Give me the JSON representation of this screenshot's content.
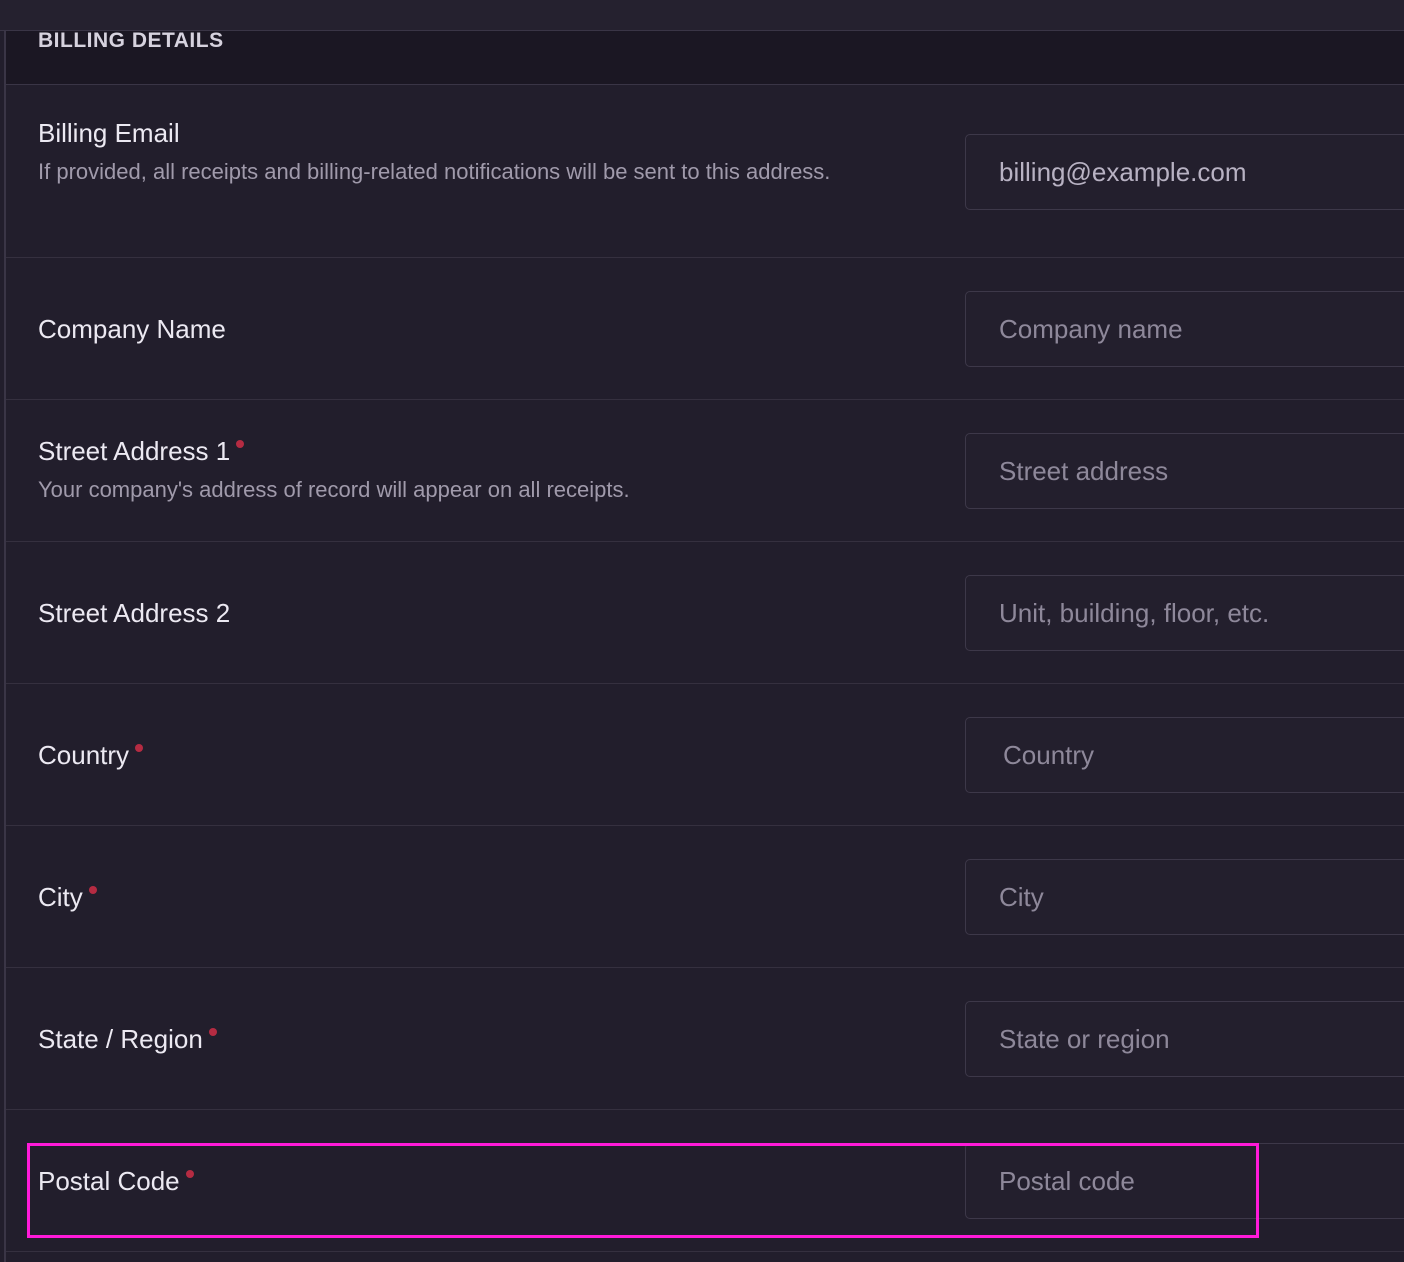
{
  "section": {
    "title": "BILLING DETAILS"
  },
  "fields": {
    "billing_email": {
      "label": "Billing Email",
      "help": "If provided, all receipts and billing-related notifications will be sent to this address.",
      "value": "billing@example.com",
      "required": false
    },
    "company_name": {
      "label": "Company Name",
      "placeholder": "Company name",
      "required": false
    },
    "street_address_1": {
      "label": "Street Address 1",
      "help": "Your company's address of record will appear on all receipts.",
      "placeholder": "Street address",
      "required": true
    },
    "street_address_2": {
      "label": "Street Address 2",
      "placeholder": "Unit, building, floor, etc.",
      "required": false
    },
    "country": {
      "label": "Country",
      "placeholder": "Country",
      "required": true
    },
    "city": {
      "label": "City",
      "placeholder": "City",
      "required": true
    },
    "state_region": {
      "label": "State / Region",
      "placeholder": "State or region",
      "required": true
    },
    "postal_code": {
      "label": "Postal Code",
      "placeholder": "Postal code",
      "required": true
    }
  },
  "colors": {
    "background": "#221e2c",
    "header_background": "#1b1723",
    "required_dot": "#b52b42",
    "highlight": "#ff1ad9"
  }
}
